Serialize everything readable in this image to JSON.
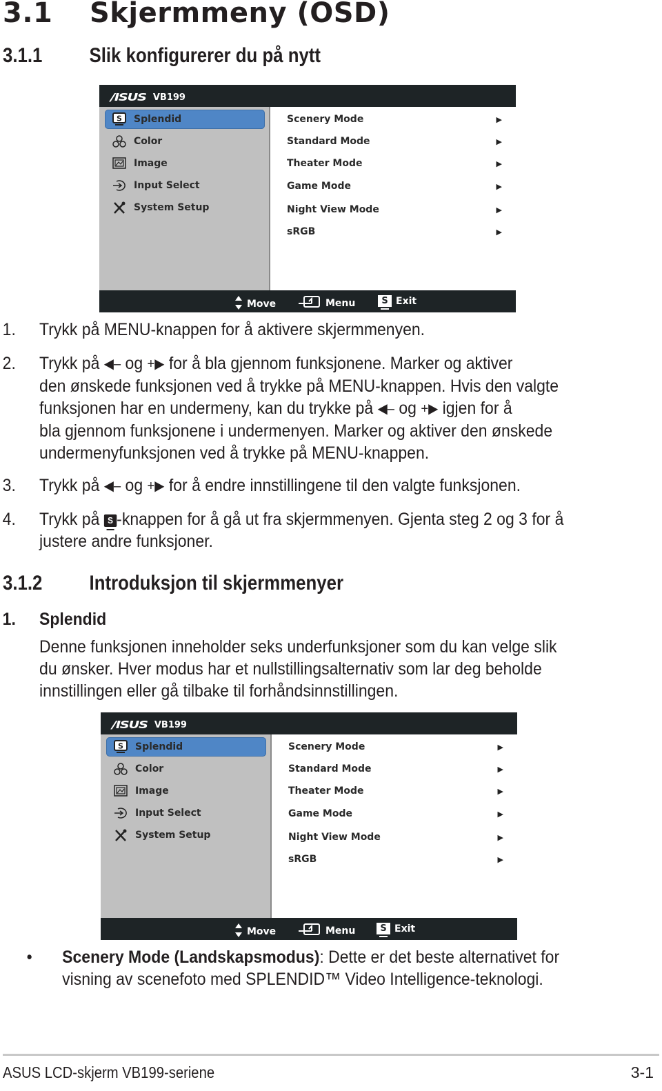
{
  "heading": {
    "number": "3.1",
    "title": "Skjermmeny (OSD)"
  },
  "section_1": {
    "number": "3.1.1",
    "title": "Slik konfigurerer du på nytt"
  },
  "osd": {
    "logo": "/ISUS",
    "model": "VB199",
    "menu_items": [
      {
        "label": "Splendid",
        "icon": "splendid-s-icon",
        "selected": true
      },
      {
        "label": "Color",
        "icon": "color-icon",
        "selected": false
      },
      {
        "label": "Image",
        "icon": "image-icon",
        "selected": false
      },
      {
        "label": "Input Select",
        "icon": "input-select-icon",
        "selected": false
      },
      {
        "label": "System Setup",
        "icon": "system-setup-icon",
        "selected": false
      }
    ],
    "submenu_items": [
      {
        "label": "Scenery Mode",
        "arrow": "▶"
      },
      {
        "label": "Standard Mode",
        "arrow": "▶"
      },
      {
        "label": "Theater Mode",
        "arrow": "▶"
      },
      {
        "label": "Game Mode",
        "arrow": "▶"
      },
      {
        "label": "Night View Mode",
        "arrow": "▶"
      },
      {
        "label": "sRGB",
        "arrow": "▶"
      }
    ],
    "footer": {
      "move": "Move",
      "menu": "Menu",
      "exit": "Exit",
      "exit_key": "S"
    },
    "colors": {
      "header_bg": "#1e2426",
      "left_bg": "#c0c0c0",
      "selected_bg": "#4f86c6",
      "right_bg": "#ffffff"
    }
  },
  "steps": [
    {
      "num": "1.",
      "lines": [
        "Trykk på MENU-knappen for å aktivere skjermmenyen."
      ]
    },
    {
      "num": "2.",
      "line1_a": "Trykk på",
      "line1_og": "og",
      "line1_b": "for å bla gjennom funksjonene. Marker og aktiver",
      "line2": "den ønskede funksjonen ved å trykke på MENU-knappen. Hvis den valgte",
      "line3_a": "funksjonen har en undermeny, kan du trykke på",
      "line3_og": "og",
      "line3_b": "igjen for å",
      "line4": "bla gjennom funksjonene i undermenyen. Marker og aktiver den ønskede",
      "line5": "undermenyfunksjonen ved å trykke på MENU-knappen."
    },
    {
      "num": "3.",
      "a": "Trykk på",
      "og": "og",
      "b": "for å endre innstillingene til den valgte funksjonen."
    },
    {
      "num": "4.",
      "a": "Trykk på",
      "key": "S",
      "b": "-knappen for å gå ut fra skjermmenyen. Gjenta steg 2 og 3 for å",
      "line2": "justere andre funksjoner."
    }
  ],
  "keys": {
    "minus": "◀–",
    "plus": "+▶"
  },
  "section_2": {
    "number": "3.1.2",
    "title": "Introduksjon til skjermmenyer"
  },
  "splendid": {
    "num": "1.",
    "title": "Splendid",
    "lines": [
      "Denne funksjonen inneholder seks underfunksjoner som du kan velge slik",
      "du ønsker. Hver modus har et nullstillingsalternativ som lar deg beholde",
      "innstillingen eller gå tilbake til forhåndsinnstillingen."
    ]
  },
  "bullet": {
    "symbol": "•",
    "bold": "Scenery Mode (Landskapsmodus)",
    "text": ": Dette er det beste alternativet for",
    "line2": "visning av scenefoto med SPLENDID™ Video Intelligence-teknologi."
  },
  "footer": {
    "left": "ASUS LCD-skjerm VB199-seriene",
    "right": "3-1"
  }
}
